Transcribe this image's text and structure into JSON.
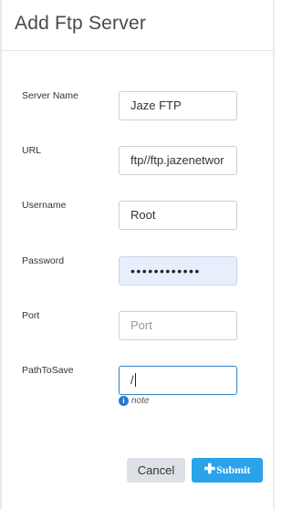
{
  "dialog": {
    "title": "Add Ftp Server"
  },
  "fields": {
    "server_name": {
      "label": "Server Name",
      "value": "Jaze FTP"
    },
    "url": {
      "label": "URL",
      "value": "ftp//ftp.jazenetwor"
    },
    "username": {
      "label": "Username",
      "value": "Root"
    },
    "password": {
      "label": "Password",
      "value": "••••••••••••"
    },
    "port": {
      "label": "Port",
      "placeholder": "Port",
      "value": ""
    },
    "path_to_save": {
      "label": "PathToSave",
      "value": "/",
      "hint": "note"
    }
  },
  "buttons": {
    "cancel_label": "Cancel",
    "submit_label": "Submit"
  },
  "icons": {
    "info": "info-circle-icon",
    "submit": "plus-icon"
  },
  "colors": {
    "accent": "#2aa3ea",
    "focus_border": "#3d86c6",
    "autofill_bg": "#e8eefc",
    "cancel_bg": "#dde1e6"
  }
}
